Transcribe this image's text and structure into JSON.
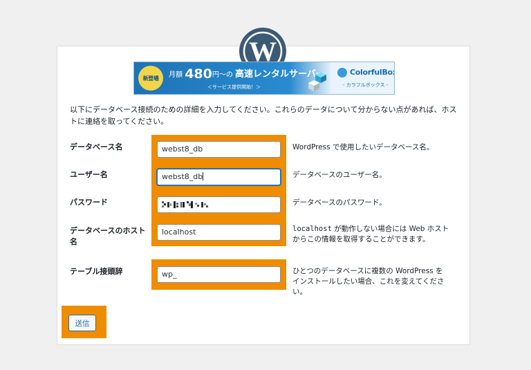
{
  "logo": {
    "icon": "wordpress-logo"
  },
  "banner": {
    "badge": "新登場",
    "prefix": "月額",
    "price": "480",
    "unit": "円～の",
    "headline": "高速レンタルサーバー",
    "sub": "＜サービス提供開始！＞",
    "brand": "ColorfulBox",
    "brand_sub": "- カラフルボックス -"
  },
  "intro": "以下にデータベース接続のための詳細を入力してください。これらのデータについて分からない点があれば、ホストに連絡を取ってください。",
  "fields": {
    "dbname": {
      "label": "データベース名",
      "value": "webst8_db",
      "desc": "WordPress で使用したいデータベース名。"
    },
    "username": {
      "label": "ユーザー名",
      "value": "webst8_db",
      "desc": "データベースのユーザー名。"
    },
    "password": {
      "label": "パスワード",
      "desc": "データベースのパスワード。"
    },
    "host": {
      "label": "データベースのホスト名",
      "value": "localhost",
      "desc_code": "localhost",
      "desc": " が動作しない場合には Web ホストからこの情報を取得することができます。"
    },
    "prefix": {
      "label": "テーブル接頭辞",
      "value": "wp_",
      "desc": "ひとつのデータベースに複数の WordPress をインストールしたい場合、これを変えてください。"
    }
  },
  "submit_label": "送信",
  "colors": {
    "highlight": "#f08c00",
    "accent": "#2271b1",
    "logo": "#3c5a75"
  }
}
